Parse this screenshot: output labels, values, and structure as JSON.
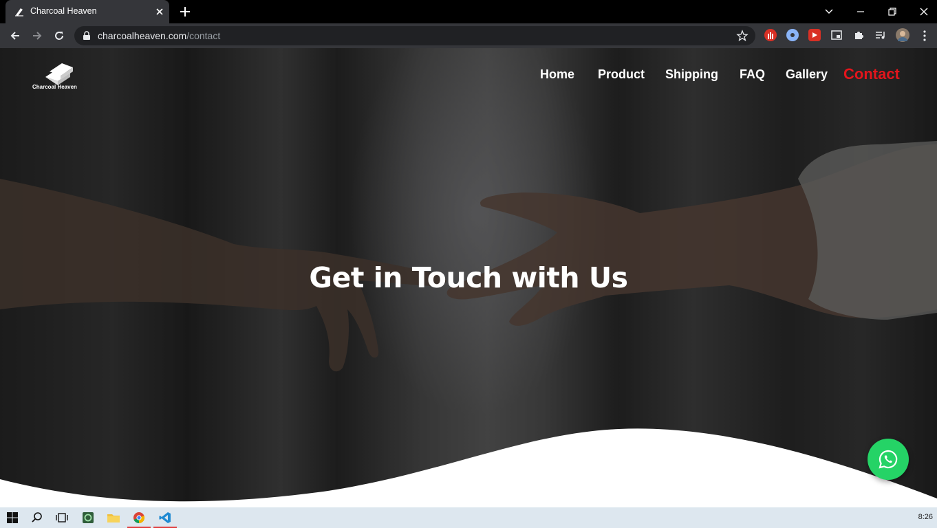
{
  "browser": {
    "tab_title": "Charcoal Heaven",
    "url_host": "charcoalheaven.com",
    "url_path": "/contact",
    "icons": [
      "back-icon",
      "forward-icon",
      "reload-icon",
      "lock-icon",
      "bookmark-star-icon",
      "extension-icon",
      "puzzle-icon",
      "media-icon",
      "profile-avatar"
    ]
  },
  "site": {
    "logo_text": "Charcoal Heaven",
    "nav": [
      {
        "label": "Home",
        "active": false
      },
      {
        "label": "Product",
        "active": false
      },
      {
        "label": "Shipping",
        "active": false
      },
      {
        "label": "FAQ",
        "active": false
      },
      {
        "label": "Gallery",
        "active": false
      },
      {
        "label": "Contact",
        "active": true
      }
    ],
    "hero_title": "Get in Touch with Us",
    "colors": {
      "active_nav": "#e3151c",
      "whatsapp": "#25d366"
    }
  },
  "taskbar": {
    "clock": "8:26",
    "apps": [
      "windows-start-icon",
      "search-icon",
      "task-view-icon",
      "app-icon",
      "file-explorer-icon",
      "chrome-icon",
      "vscode-icon"
    ]
  }
}
